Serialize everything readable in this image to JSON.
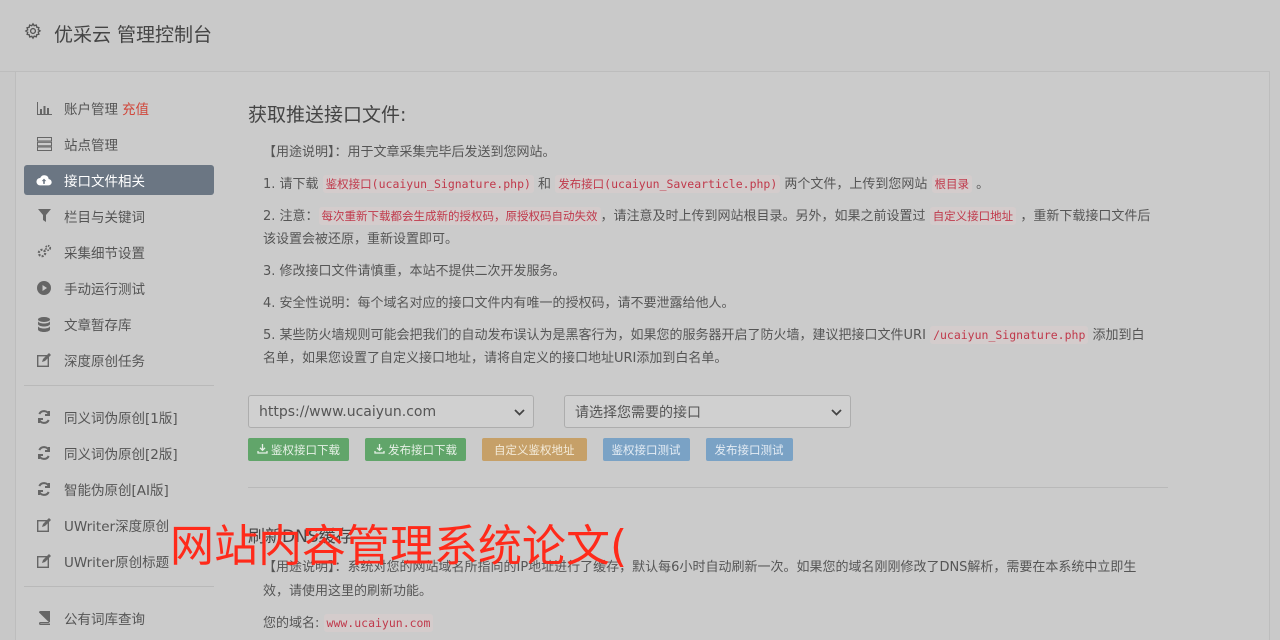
{
  "header": {
    "title": "优采云 管理控制台"
  },
  "sidebar": {
    "items": [
      {
        "label": "账户管理",
        "accent": "充值",
        "icon": "bar-chart-icon"
      },
      {
        "label": "站点管理",
        "icon": "server-icon"
      },
      {
        "label": "接口文件相关",
        "icon": "cloud-upload-icon",
        "active": true
      },
      {
        "label": "栏目与关键词",
        "icon": "filter-icon"
      },
      {
        "label": "采集细节设置",
        "icon": "cogs-icon"
      },
      {
        "label": "手动运行测试",
        "icon": "play-icon"
      },
      {
        "label": "文章暂存库",
        "icon": "database-icon"
      },
      {
        "label": "深度原创任务",
        "icon": "edit-icon"
      }
    ],
    "items2": [
      {
        "label": "同义词伪原创[1版]",
        "icon": "refresh-icon"
      },
      {
        "label": "同义词伪原创[2版]",
        "icon": "refresh-icon"
      },
      {
        "label": "智能伪原创[AI版]",
        "icon": "refresh-icon"
      },
      {
        "label": "UWriter深度原创",
        "icon": "edit-icon"
      },
      {
        "label": "UWriter原创标题",
        "icon": "edit-icon"
      }
    ],
    "items3": [
      {
        "label": "公有词库查询",
        "icon": "book-icon"
      }
    ]
  },
  "main": {
    "title": "获取推送接口文件:",
    "usage": "【用途说明】：用于文章采集完毕后发送到您网站。",
    "p1": {
      "a": "1. 请下载 ",
      "code1": "鉴权接口(ucaiyun_Signature.php)",
      "b": " 和 ",
      "code2": "发布接口(ucaiyun_Savearticle.php)",
      "c": " 两个文件，上传到您网站 ",
      "code3": "根目录",
      "d": " 。"
    },
    "p2": {
      "a": "2. 注意：",
      "code1": "每次重新下载都会生成新的授权码，原授权码自动失效",
      "b": "，请注意及时上传到网站根目录。另外，如果之前设置过 ",
      "code2": "自定义接口地址",
      "c": " ，重新下载接口文件后该设置会被还原，重新设置即可。"
    },
    "p3": "3. 修改接口文件请慎重，本站不提供二次开发服务。",
    "p4": "4. 安全性说明：每个域名对应的接口文件内有唯一的授权码，请不要泄露给他人。",
    "p5": {
      "a": "5. 某些防火墙规则可能会把我们的自动发布误认为是黑客行为，如果您的服务器开启了防火墙，建议把接口文件URI ",
      "code1": "/ucaiyun_Signature.php",
      "b": " 添加到白名单，如果您设置了自定义接口地址，请将自定义的接口地址URI添加到白名单。"
    },
    "select_site": "https://www.ucaiyun.com",
    "select_api": "请选择您需要的接口",
    "buttons": {
      "auth_download": "鉴权接口下载",
      "publish_download": "发布接口下载",
      "custom_auth": "自定义鉴权地址",
      "auth_test": "鉴权接口测试",
      "publish_test": "发布接口测试"
    }
  },
  "section2": {
    "title": "刷新DNS缓存",
    "usage": "【用途说明】：系统对您的网站域名所指向的IP地址进行了缓存，默认每6小时自动刷新一次。如果您的域名刚刚修改了DNS解析，需要在本系统中立即生效，请使用这里的刷新功能。",
    "domain_label": "您的域名:",
    "domain_value": "www.ucaiyun.com"
  },
  "overlay_text": "网站内容管理系统论文("
}
